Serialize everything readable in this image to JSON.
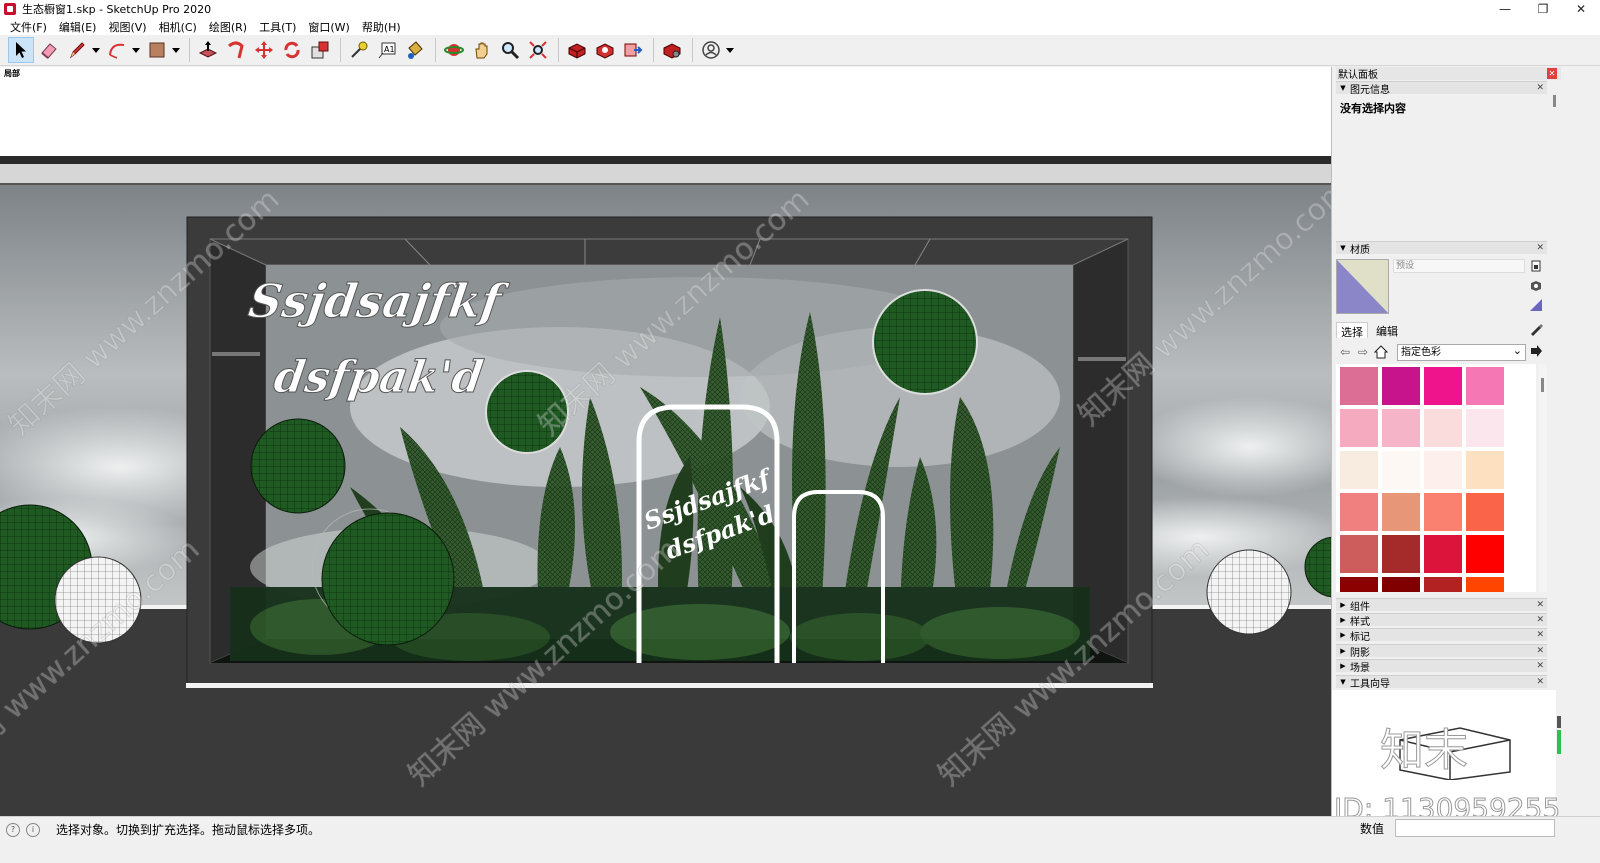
{
  "window": {
    "title": "生态橱窗1.skp - SketchUp Pro 2020",
    "controls": [
      "—",
      "❐",
      "✕"
    ]
  },
  "menu": [
    "文件(F)",
    "编辑(E)",
    "视图(V)",
    "相机(C)",
    "绘图(R)",
    "工具(T)",
    "窗口(W)",
    "帮助(H)"
  ],
  "viewport": {
    "scene_label": "局部",
    "sign_text_line1": "Ssjdsajfkf",
    "sign_text_line2": "dsfpak'd",
    "small_sign_line1": "Ssjdsajfkf",
    "small_sign_line2": "dsfpak'd",
    "watermark": "知末网 www.znzmo.com"
  },
  "tray": {
    "title": "默认面板",
    "pin": "⊡",
    "entity_info": {
      "label": "图元信息",
      "empty_text": "没有选择内容"
    },
    "materials": {
      "label": "材质",
      "name_placeholder": "预设",
      "tabs": [
        "选择",
        "编辑"
      ],
      "collection": "指定色彩",
      "swatches": [
        [
          "#dc6e96",
          "#c8148c",
          "#f0148c",
          "#f578b4"
        ],
        [
          "#f5aac0",
          "#f5b4c8",
          "#fadcdc",
          "#fbe6ee"
        ],
        [
          "#f8ece0",
          "#fdf8f4",
          "#fdf0ec",
          "#fde0c0"
        ],
        [
          "#f08080",
          "#e89678",
          "#fa8070",
          "#fa6448"
        ],
        [
          "#cd5c5c",
          "#a52a2a",
          "#dc143c",
          "#ff0000"
        ],
        [
          "#8b0000",
          "#800000",
          "#b22222",
          "#ff4500"
        ]
      ]
    },
    "collapsed_panels": [
      "组件",
      "样式",
      "标记",
      "阴影",
      "场景"
    ],
    "instructor": {
      "label": "工具向导"
    },
    "id_text": "ID: 1130959255"
  },
  "status": {
    "message": "选择对象。切换到扩充选择。拖动鼠标选择多项。",
    "measurements_label": "数值"
  }
}
